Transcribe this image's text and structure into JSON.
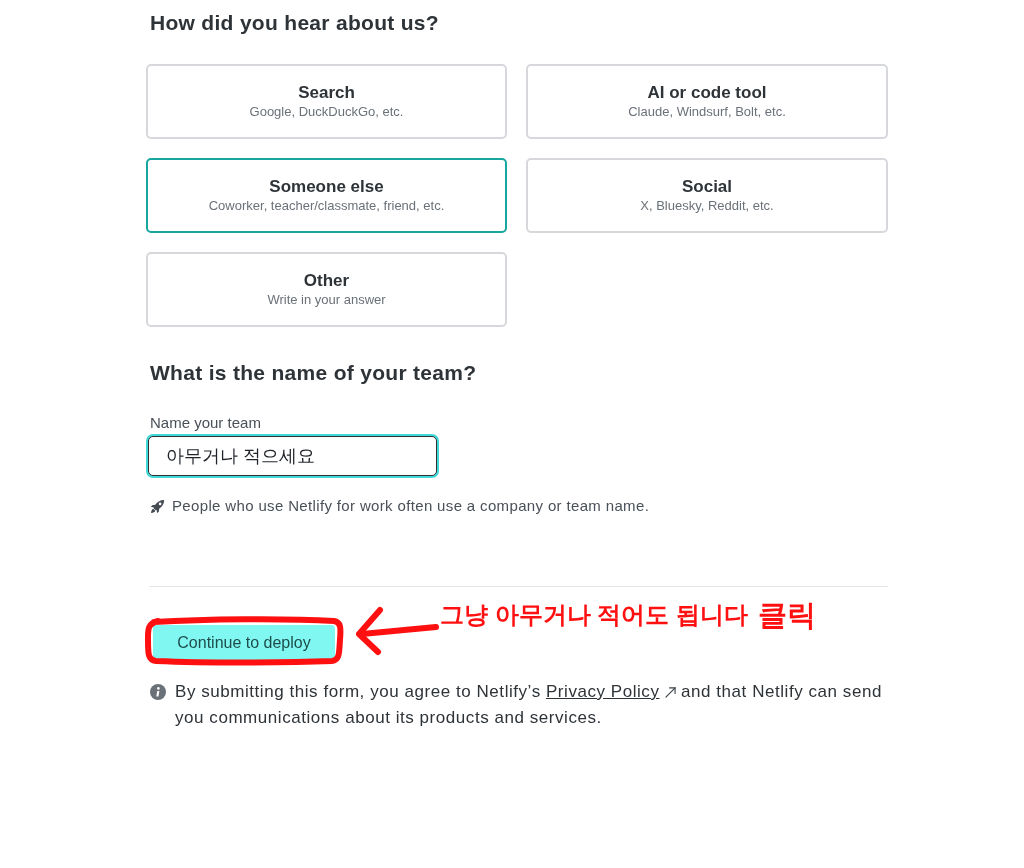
{
  "question": {
    "title": "How did you hear about us?",
    "options": [
      {
        "label": "Search",
        "description": "Google, DuckDuckGo, etc.",
        "selected": false
      },
      {
        "label": "AI or code tool",
        "description": "Claude, Windsurf, Bolt, etc.",
        "selected": false
      },
      {
        "label": "Someone else",
        "description": "Coworker, teacher/classmate, friend, etc.",
        "selected": true
      },
      {
        "label": "Social",
        "description": "X, Bluesky, Reddit, etc.",
        "selected": false
      },
      {
        "label": "Other",
        "description": "Write in your answer",
        "selected": false
      }
    ]
  },
  "team": {
    "title": "What is the name of your team?",
    "field": {
      "label": "Name your team",
      "value": "아무거나 적으세요",
      "focused": true
    },
    "hint": "People who use Netlify for work often use a company or team name."
  },
  "submit": {
    "label": "Continue to deploy"
  },
  "annotation": {
    "note": "그냥 아무거나 적어도 됩니다",
    "emphasis": "클릭"
  },
  "consent": {
    "before": "By submitting this form, you agree to Netlify’s",
    "link": "Privacy Policy",
    "after": "and that Netlify can send you communications about its products and services."
  }
}
